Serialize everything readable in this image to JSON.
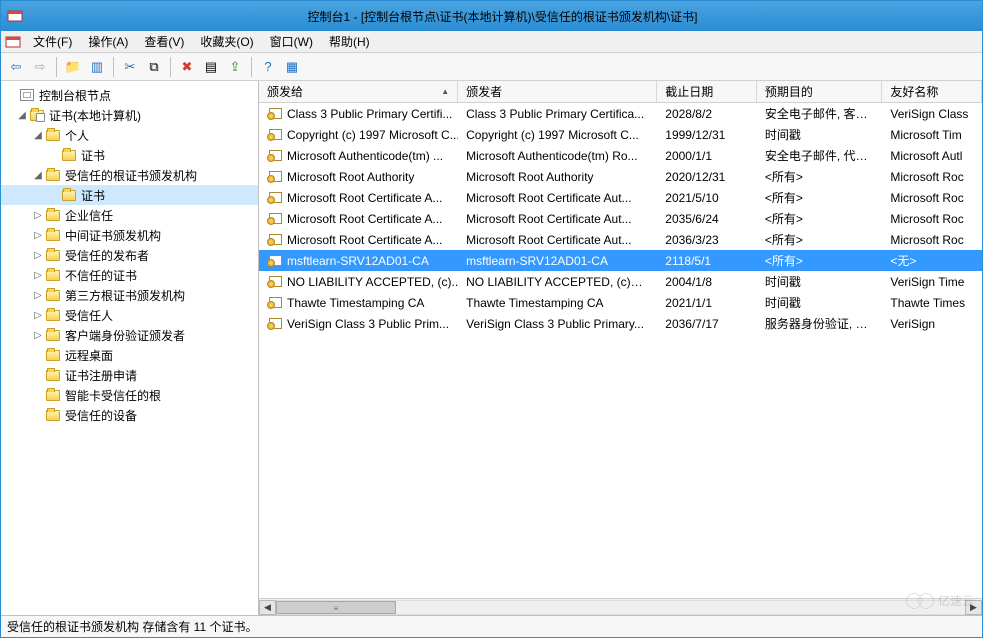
{
  "window": {
    "title": "控制台1 - [控制台根节点\\证书(本地计算机)\\受信任的根证书颁发机构\\证书]"
  },
  "menu": {
    "file": "文件(F)",
    "action": "操作(A)",
    "view": "查看(V)",
    "favorites": "收藏夹(O)",
    "window": "窗口(W)",
    "help": "帮助(H)"
  },
  "toolbar_icons": {
    "back": "arrow-left",
    "forward": "arrow-right",
    "up": "folder-up",
    "show_hide": "panel-toggle",
    "cut": "scissors",
    "copy": "copy",
    "delete": "delete-x",
    "properties": "properties",
    "export": "export",
    "help": "help",
    "refresh": "refresh"
  },
  "tree": {
    "root": "控制台根节点",
    "certs_local": "证书(本地计算机)",
    "personal": "个人",
    "personal_certs": "证书",
    "trusted_root": "受信任的根证书颁发机构",
    "trusted_root_certs": "证书",
    "enterprise_trust": "企业信任",
    "intermediate": "中间证书颁发机构",
    "trusted_publishers": "受信任的发布者",
    "untrusted": "不信任的证书",
    "third_party_root": "第三方根证书颁发机构",
    "trusted_people": "受信任人",
    "client_auth_issuers": "客户端身份验证颁发者",
    "remote_desktop": "远程桌面",
    "cert_enrollment": "证书注册申请",
    "smart_card_trusted": "智能卡受信任的根",
    "trusted_devices": "受信任的设备"
  },
  "columns": {
    "issued_to": "颁发给",
    "issued_by": "颁发者",
    "expiration": "截止日期",
    "intended": "预期目的",
    "friendly": "友好名称"
  },
  "rows": [
    {
      "issued_to": "Class 3 Public Primary Certifi...",
      "issued_by": "Class 3 Public Primary Certifica...",
      "exp": "2028/8/2",
      "purpose": "安全电子邮件, 客户...",
      "friendly": "VeriSign Class"
    },
    {
      "issued_to": "Copyright (c) 1997 Microsoft C...",
      "issued_by": "Copyright (c) 1997 Microsoft C...",
      "exp": "1999/12/31",
      "purpose": "时间戳",
      "friendly": "Microsoft Tim"
    },
    {
      "issued_to": "Microsoft Authenticode(tm) ...",
      "issued_by": "Microsoft Authenticode(tm) Ro...",
      "exp": "2000/1/1",
      "purpose": "安全电子邮件, 代码...",
      "friendly": "Microsoft Autl"
    },
    {
      "issued_to": "Microsoft Root Authority",
      "issued_by": "Microsoft Root Authority",
      "exp": "2020/12/31",
      "purpose": "<所有>",
      "friendly": "Microsoft Roc"
    },
    {
      "issued_to": "Microsoft Root Certificate A...",
      "issued_by": "Microsoft Root Certificate Aut...",
      "exp": "2021/5/10",
      "purpose": "<所有>",
      "friendly": "Microsoft Roc"
    },
    {
      "issued_to": "Microsoft Root Certificate A...",
      "issued_by": "Microsoft Root Certificate Aut...",
      "exp": "2035/6/24",
      "purpose": "<所有>",
      "friendly": "Microsoft Roc"
    },
    {
      "issued_to": "Microsoft Root Certificate A...",
      "issued_by": "Microsoft Root Certificate Aut...",
      "exp": "2036/3/23",
      "purpose": "<所有>",
      "friendly": "Microsoft Roc"
    },
    {
      "issued_to": "msftlearn-SRV12AD01-CA",
      "issued_by": "msftlearn-SRV12AD01-CA",
      "exp": "2118/5/1",
      "purpose": "<所有>",
      "friendly": "<无>",
      "selected": true
    },
    {
      "issued_to": "NO LIABILITY ACCEPTED, (c)...",
      "issued_by": "NO LIABILITY ACCEPTED, (c)97...",
      "exp": "2004/1/8",
      "purpose": "时间戳",
      "friendly": "VeriSign Time"
    },
    {
      "issued_to": "Thawte Timestamping CA",
      "issued_by": "Thawte Timestamping CA",
      "exp": "2021/1/1",
      "purpose": "时间戳",
      "friendly": "Thawte Times"
    },
    {
      "issued_to": "VeriSign Class 3 Public Prim...",
      "issued_by": "VeriSign Class 3 Public Primary...",
      "exp": "2036/7/17",
      "purpose": "服务器身份验证, 客...",
      "friendly": "VeriSign"
    }
  ],
  "status": "受信任的根证书颁发机构 存储含有 11 个证书。",
  "watermark": "亿速云"
}
